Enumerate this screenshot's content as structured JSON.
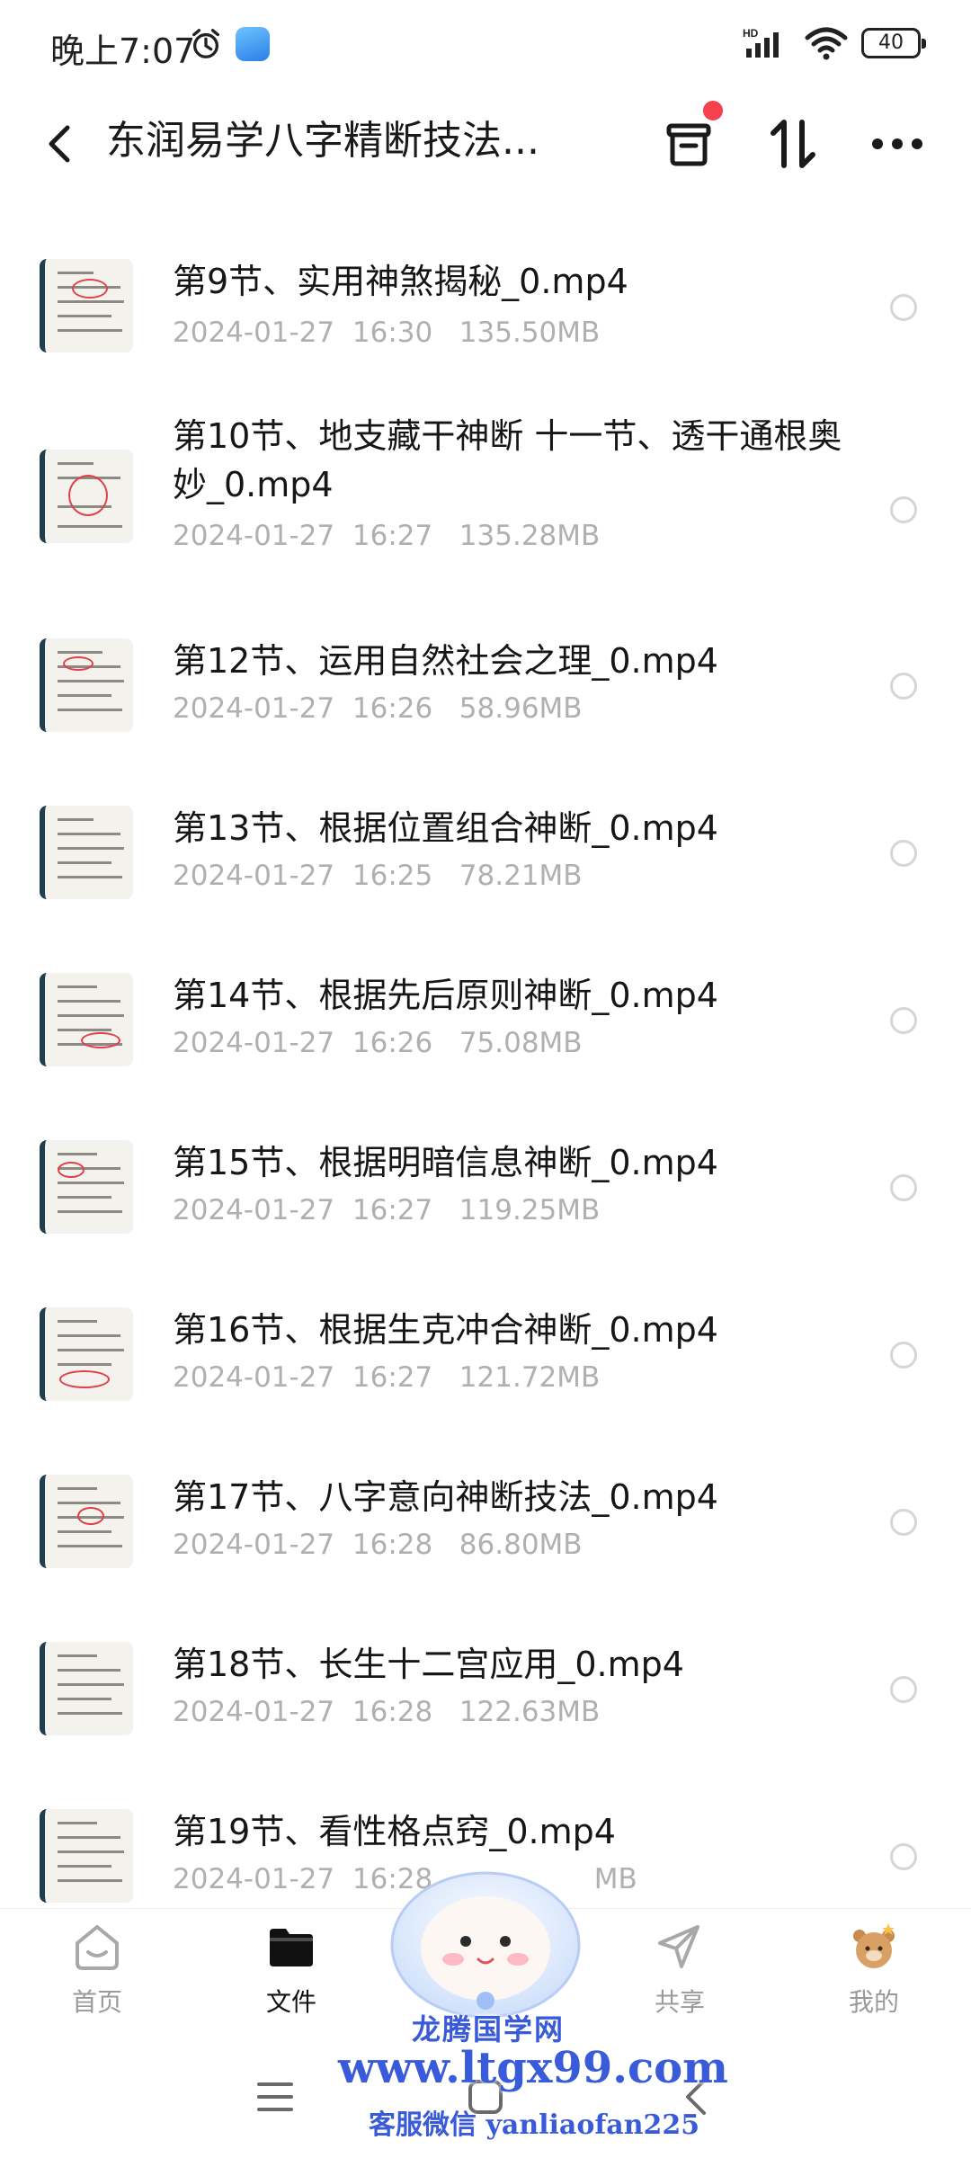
{
  "status_bar": {
    "time": "晚上7:07",
    "network": "HD",
    "battery": "40"
  },
  "header": {
    "title": "东润易学八字精断技法...",
    "icons": [
      "back-icon",
      "archive-icon",
      "sort-icon",
      "more-icon"
    ],
    "notification_dot_color": "#f5414d"
  },
  "files": [
    {
      "name": "第9节、实用神煞揭秘_0.mp4",
      "date": "2024-01-27",
      "time": "16:30",
      "size": "135.50MB"
    },
    {
      "name": "第10节、地支藏干神断      十一节、透干通根奥妙_0.mp4",
      "date": "2024-01-27",
      "time": "16:27",
      "size": "135.28MB"
    },
    {
      "name": "第12节、运用自然社会之理_0.mp4",
      "date": "2024-01-27",
      "time": "16:26",
      "size": "58.96MB"
    },
    {
      "name": "第13节、根据位置组合神断_0.mp4",
      "date": "2024-01-27",
      "time": "16:25",
      "size": "78.21MB"
    },
    {
      "name": "第14节、根据先后原则神断_0.mp4",
      "date": "2024-01-27",
      "time": "16:26",
      "size": "75.08MB"
    },
    {
      "name": "第15节、根据明暗信息神断_0.mp4",
      "date": "2024-01-27",
      "time": "16:27",
      "size": "119.25MB"
    },
    {
      "name": "第16节、根据生克冲合神断_0.mp4",
      "date": "2024-01-27",
      "time": "16:27",
      "size": "121.72MB"
    },
    {
      "name": "第17节、八字意向神断技法_0.mp4",
      "date": "2024-01-27",
      "time": "16:28",
      "size": "86.80MB"
    },
    {
      "name": "第18节、长生十二宫应用_0.mp4",
      "date": "2024-01-27",
      "time": "16:28",
      "size": "122.63MB"
    },
    {
      "name": "第19节、看性格点窍_0.mp4",
      "date": "2024-01-27",
      "time": "16:28",
      "size": "MB"
    }
  ],
  "bottom_nav": [
    {
      "label": "首页",
      "icon": "home-icon"
    },
    {
      "label": "文件",
      "icon": "folder-icon",
      "active": true
    },
    {
      "label": "",
      "icon": "assistant-icon"
    },
    {
      "label": "共享",
      "icon": "share-icon"
    },
    {
      "label": "我的",
      "icon": "profile-icon"
    }
  ],
  "watermark": {
    "line1": "龙腾国学网",
    "line2": "www.ltgx99.com",
    "line3": "客服微信 yanliaofan225"
  },
  "colors": {
    "primary_text": "#161616",
    "meta_text": "#b0b0b0",
    "watermark": "#3a5bd9"
  }
}
